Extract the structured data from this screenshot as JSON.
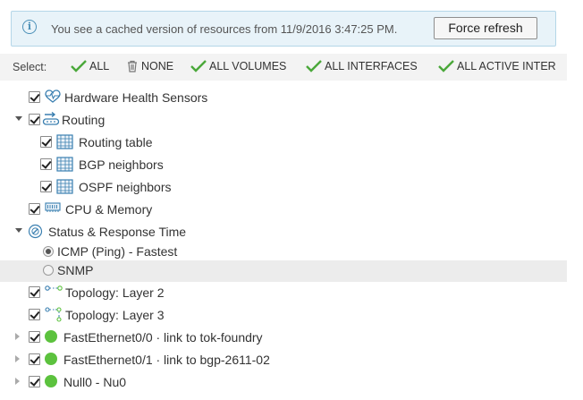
{
  "banner": {
    "message": "You see a cached version of resources from 11/9/2016 3:47:25 PM.",
    "force_refresh_label": "Force refresh"
  },
  "select_bar": {
    "label": "Select:",
    "items": [
      {
        "label": "ALL",
        "icon": "check-icon"
      },
      {
        "label": "NONE",
        "icon": "trash-icon"
      },
      {
        "label": "ALL VOLUMES",
        "icon": "check-icon"
      },
      {
        "label": "ALL INTERFACES",
        "icon": "check-icon"
      },
      {
        "label": "ALL ACTIVE INTER",
        "icon": "check-icon"
      }
    ]
  },
  "tree": [
    {
      "label": "Hardware Health Sensors",
      "icon": "heart-pulse-icon",
      "checked": true
    },
    {
      "label": "Routing",
      "icon": "routing-icon",
      "checked": true,
      "expanded": true
    },
    {
      "label": "Routing table",
      "icon": "table-icon",
      "checked": true
    },
    {
      "label": "BGP neighbors",
      "icon": "table-icon",
      "checked": true
    },
    {
      "label": "OSPF neighbors",
      "icon": "table-icon",
      "checked": true
    },
    {
      "label": "CPU & Memory",
      "icon": "memory-icon",
      "checked": true
    },
    {
      "label": "Status & Response Time",
      "icon": "gauge-icon",
      "expanded": true
    },
    {
      "label": "ICMP (Ping) - Fastest",
      "selected": true
    },
    {
      "label": "SNMP",
      "selected": false
    },
    {
      "label": "Topology: Layer 2",
      "icon": "topology-icon",
      "checked": true
    },
    {
      "label": "Topology: Layer 3",
      "icon": "topology-icon",
      "checked": true
    },
    {
      "label": "FastEthernet0/0 · link to tok-foundry",
      "icon": "status-up-icon",
      "checked": true
    },
    {
      "label": "FastEthernet0/1 · link to bgp-2611-02",
      "icon": "status-up-icon",
      "checked": true
    },
    {
      "label": "Null0 - Nu0",
      "icon": "status-up-icon",
      "checked": true
    }
  ],
  "colors": {
    "status_up": "#5cc23e",
    "accent": "#3a7fb0",
    "check_green": "#4aa83a"
  }
}
